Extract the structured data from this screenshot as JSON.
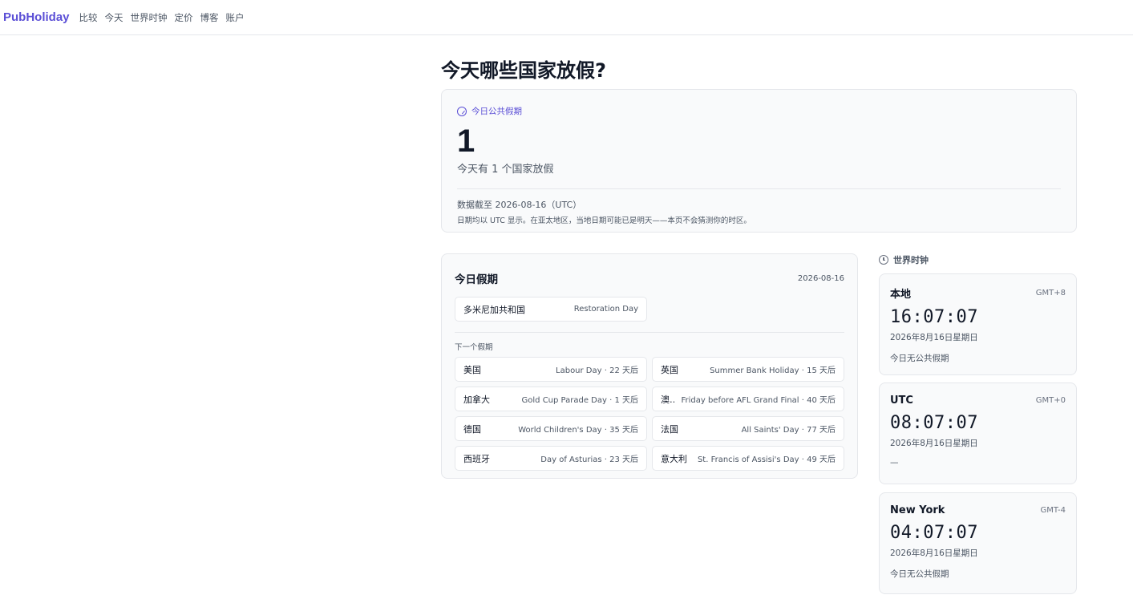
{
  "nav": {
    "brand": "PubHoliday",
    "links": [
      "比较",
      "今天",
      "世界时钟",
      "定价",
      "博客",
      "账户"
    ]
  },
  "headline": "今天哪些国家放假?",
  "summary": {
    "pill": "今日公共假期",
    "count": "1",
    "count_text": "今天有 1 个国家放假",
    "as_of": "数据截至 2026-08-16（UTC）",
    "note": "日期均以 UTC 显示。在亚太地区，当地日期可能已是明天——本页不会猜测你的时区。"
  },
  "today_holidays": {
    "title": "今日假期",
    "date": "2026-08-16",
    "items": [
      {
        "country": "多米尼加共和国",
        "holiday": "Restoration Day"
      }
    ],
    "next_label": "下一个假期",
    "next": [
      {
        "country": "美国",
        "info": "Labour Day · 22 天后"
      },
      {
        "country": "英国",
        "info": "Summer Bank Holiday · 15 天后"
      },
      {
        "country": "加拿大",
        "info": "Gold Cup Parade Day · 1 天后"
      },
      {
        "country": "澳大利亚",
        "info": "Friday before AFL Grand Final · 40 天后"
      },
      {
        "country": "德国",
        "info": "World Children's Day · 35 天后"
      },
      {
        "country": "法国",
        "info": "All Saints' Day · 77 天后"
      },
      {
        "country": "西班牙",
        "info": "Day of Asturias · 23 天后"
      },
      {
        "country": "意大利",
        "info": "St. Francis of Assisi's Day · 49 天后"
      }
    ]
  },
  "world_clock": {
    "label": "世界时钟",
    "cards": [
      {
        "city": "本地",
        "tz": "GMT+8",
        "time": "16:07:07",
        "date": "2026年8月16日星期日",
        "status": "今日无公共假期"
      },
      {
        "city": "UTC",
        "tz": "GMT+0",
        "time": "08:07:07",
        "date": "2026年8月16日星期日",
        "status": "—"
      },
      {
        "city": "New York",
        "tz": "GMT-4",
        "time": "04:07:07",
        "date": "2026年8月16日星期日",
        "status": "今日无公共假期"
      }
    ]
  },
  "colors": {
    "brand": "#5b4fd6",
    "card_bg": "#f9fafb",
    "border": "#e5e7eb"
  },
  "icons": {
    "pill": "globe-icon",
    "clock": "clock-icon"
  }
}
